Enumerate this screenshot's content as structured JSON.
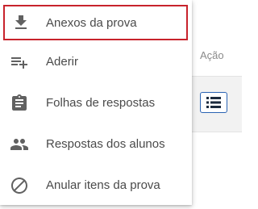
{
  "table": {
    "action_header": "Ação",
    "row_action_icon": "list-icon"
  },
  "menu": {
    "items": [
      {
        "label": "Anexos da prova",
        "icon": "download-icon",
        "highlighted": true
      },
      {
        "label": "Aderir",
        "icon": "playlist-add-icon"
      },
      {
        "label": "Folhas de respostas",
        "icon": "clipboard-icon"
      },
      {
        "label": "Respostas dos alunos",
        "icon": "people-icon"
      },
      {
        "label": "Anular itens da prova",
        "icon": "block-icon"
      }
    ]
  },
  "colors": {
    "highlight_border": "#c8232c",
    "icon": "#616161",
    "text": "#4a4a4a",
    "action_button_border": "#2a63b3",
    "action_icon": "#1b2a3d"
  }
}
